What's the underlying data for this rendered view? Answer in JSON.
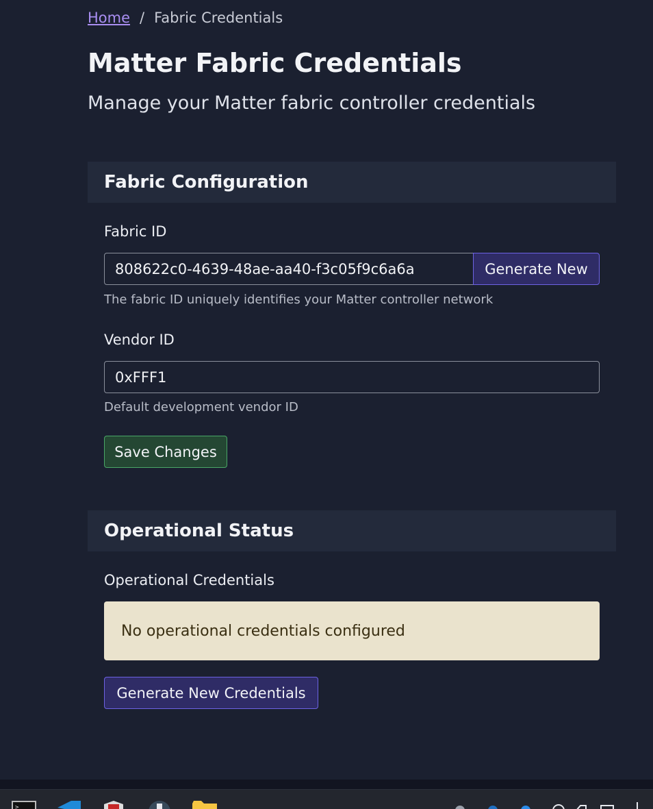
{
  "breadcrumb": {
    "home_label": "Home",
    "separator": "/",
    "current_label": "Fabric Credentials"
  },
  "header": {
    "title": "Matter Fabric Credentials",
    "subtitle": "Manage your Matter fabric controller credentials"
  },
  "fabric_configuration": {
    "title": "Fabric Configuration",
    "fabric_id": {
      "label": "Fabric ID",
      "value": "808622c0-4639-48ae-aa40-f3c05f9c6a6a",
      "generate_button": "Generate New",
      "help": "The fabric ID uniquely identifies your Matter controller network"
    },
    "vendor_id": {
      "label": "Vendor ID",
      "value": "0xFFF1",
      "help": "Default development vendor ID"
    },
    "save_button": "Save Changes"
  },
  "operational_status": {
    "title": "Operational Status",
    "credentials_label": "Operational Credentials",
    "alert_text": "No operational credentials configured",
    "generate_button": "Generate New Credentials"
  },
  "taskbar": {
    "icons": [
      "terminal-icon",
      "vscode-icon",
      "app-shield-icon",
      "app-round-icon",
      "file-explorer-icon",
      "tray-icons"
    ]
  },
  "colors": {
    "background": "#1b2030",
    "card_header": "#232a3b",
    "link": "#a98ef2",
    "primary_button": "#2f2c66",
    "primary_border": "#6d63e4",
    "success_button": "#244733",
    "success_border": "#4aa767",
    "alert_background": "#eae3cd"
  }
}
